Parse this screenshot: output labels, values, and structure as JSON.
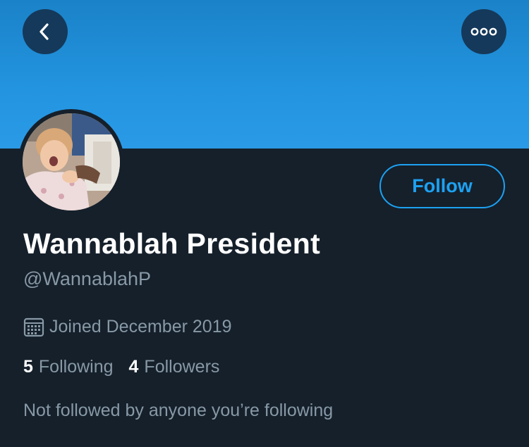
{
  "header": {
    "back_icon": "chevron-left-icon",
    "more_icon": "more-dots-icon",
    "banner_color": "#2394e0"
  },
  "profile": {
    "display_name": "Wannablah President",
    "handle": "@WannablahP",
    "joined_icon": "calendar-icon",
    "joined_text": "Joined December 2019",
    "follow_label": "Follow",
    "accent_color": "#1da1f2"
  },
  "stats": {
    "following_count": "5",
    "following_label": "Following",
    "followers_count": "4",
    "followers_label": "Followers"
  },
  "social_context": "Not followed by anyone you’re following"
}
